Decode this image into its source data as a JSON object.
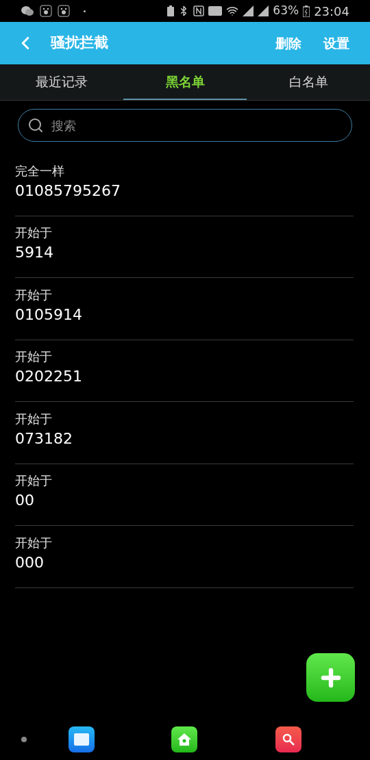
{
  "status_bar": {
    "battery_percent": "63%",
    "time": "23:04"
  },
  "header": {
    "title": "骚扰拦截",
    "actions": [
      "删除",
      "设置"
    ]
  },
  "tabs": [
    {
      "label": "最近记录",
      "selected": false
    },
    {
      "label": "黑名单",
      "selected": true
    },
    {
      "label": "白名单",
      "selected": false
    }
  ],
  "search": {
    "placeholder": "搜索"
  },
  "entries": [
    {
      "match": "完全一样",
      "number": "01085795267"
    },
    {
      "match": "开始于",
      "number": "5914"
    },
    {
      "match": "开始于",
      "number": "0105914"
    },
    {
      "match": "开始于",
      "number": "0202251"
    },
    {
      "match": "开始于",
      "number": "073182"
    },
    {
      "match": "开始于",
      "number": "00"
    },
    {
      "match": "开始于",
      "number": "000"
    }
  ]
}
